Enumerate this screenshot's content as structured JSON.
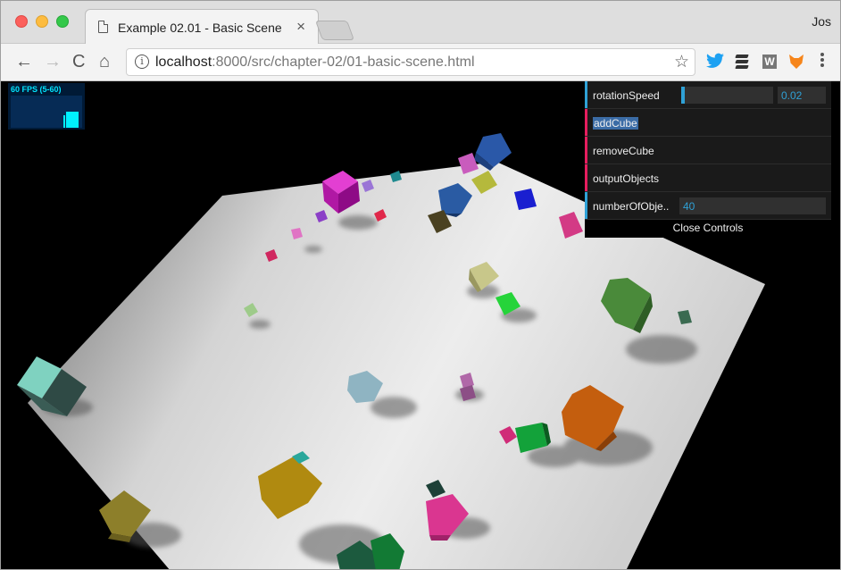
{
  "tab": {
    "title": "Example 02.01 - Basic Scene",
    "close_glyph": "×"
  },
  "profile_name": "Jos",
  "address_bar": {
    "host": "localhost",
    "rest": ":8000/src/chapter-02/01-basic-scene.html"
  },
  "icons": {
    "back": "←",
    "forward": "→",
    "reload": "C",
    "home": "⌂",
    "info": "i",
    "bookmark_star": "☆",
    "twitter": "🐦",
    "wiki": "W"
  },
  "stats": {
    "fps_text": "60 FPS (5-60)"
  },
  "gui": {
    "rotationSpeed": {
      "label": "rotationSpeed",
      "value": "0.02",
      "fraction": 0.02
    },
    "addCube": {
      "label": "addCube"
    },
    "removeCube": {
      "label": "removeCube"
    },
    "outputObjects": {
      "label": "outputObjects"
    },
    "numberOfObjects": {
      "label": "numberOfObje..",
      "value": "40"
    },
    "close_label": "Close Controls"
  },
  "scene": {
    "plane_color": "#e2e2e2",
    "background_color": "#000000"
  }
}
